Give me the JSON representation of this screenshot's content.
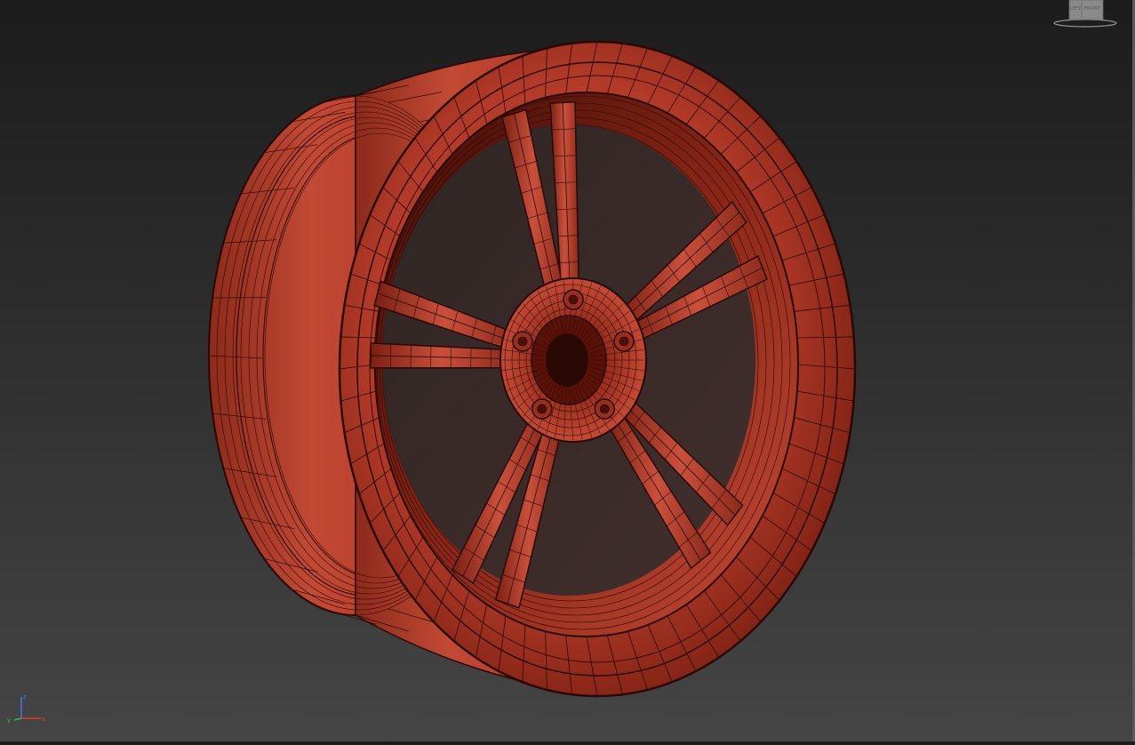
{
  "viewport": {
    "background_top": "#1c1c1c",
    "background_bottom": "#454545",
    "model": {
      "name": "wheel-rim",
      "spoke_pairs": 5,
      "lug_nuts": 5,
      "shading": "wireframe-over-shaded",
      "base_color": "#b23a28",
      "highlight_color": "#d8604c",
      "shadow_color": "#5a1208",
      "edge_color": "#2a0804"
    }
  },
  "viewcube": {
    "left_face": "LEFT",
    "front_face": "FRONT",
    "color": "#8a8a8a"
  },
  "axis_tripod": {
    "z_label": "z",
    "y_label": "y",
    "x_label": "x",
    "z_color": "#3d7ae0",
    "y_color": "#4caf50",
    "x_color": "#e03a2d"
  }
}
